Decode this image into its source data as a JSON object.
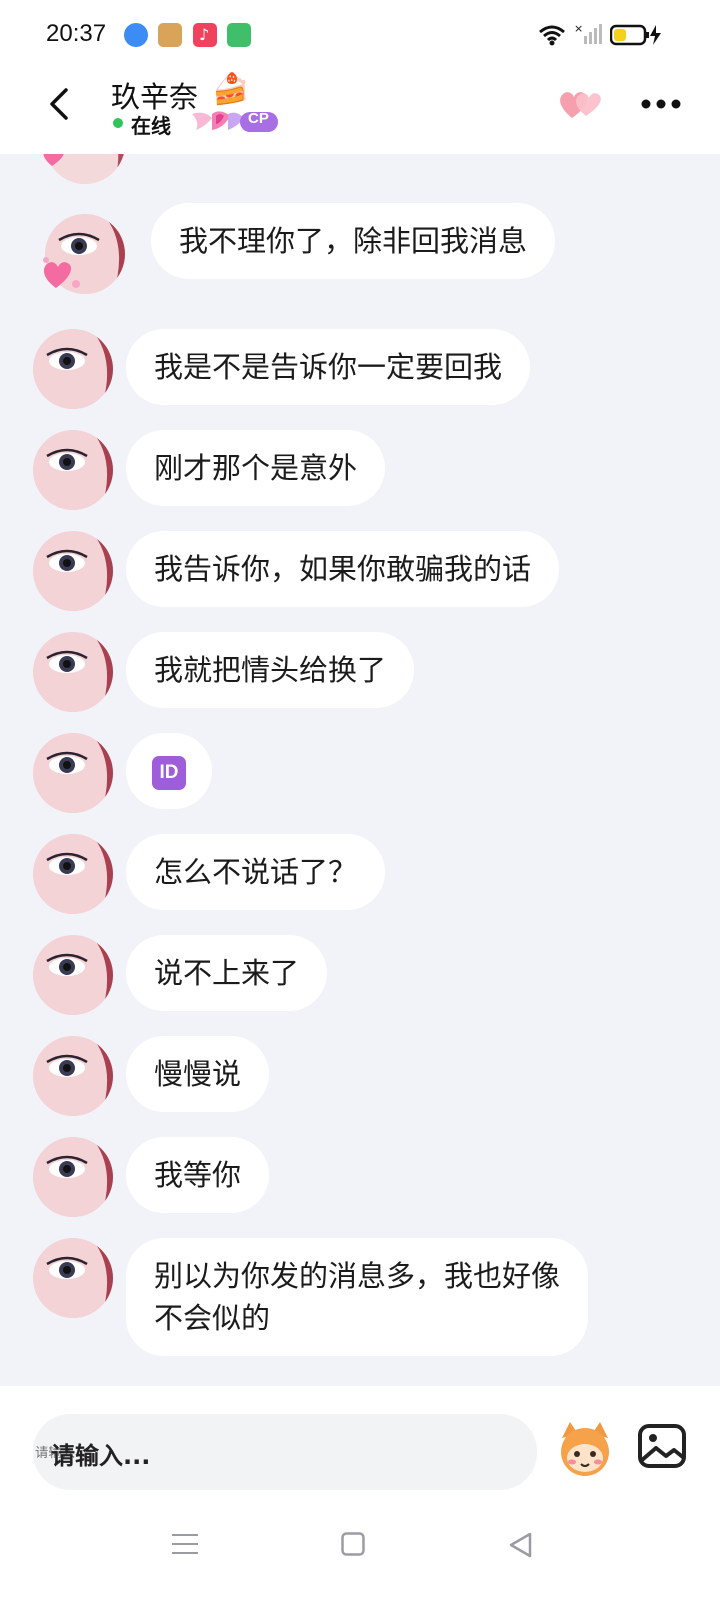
{
  "status_bar": {
    "time": "20:37",
    "app_icon_colors": [
      "#3d8cf5",
      "#d9a35a",
      "#f0425d",
      "#3fbf6a"
    ],
    "battery_color": "#f4d21c"
  },
  "header": {
    "back_icon": "chevron-left-icon",
    "contact_name": "玖辛奈",
    "name_emoji": "🍰",
    "online_status": "在线",
    "badge_label": "CP",
    "relation_icon": "double-heart-icon",
    "more_icon": "more-dots-icon",
    "accent_color": "#f48aa0"
  },
  "messages": [
    {
      "text": "我不理你了，除非回我消息"
    },
    {
      "text": "我是不是告诉你一定要回我"
    },
    {
      "text": "刚才那个是意外"
    },
    {
      "text": "我告诉你，如果你敢骗我的话"
    },
    {
      "text": "我就把情头给换了"
    },
    {
      "text": "ID",
      "kind": "id-emoji"
    },
    {
      "text": "怎么不说话了？"
    },
    {
      "text": "说不上来了"
    },
    {
      "text": "慢慢说"
    },
    {
      "text": "我等你"
    },
    {
      "text": "别以为你发的消息多，我也好像不会似的"
    }
  ],
  "composer": {
    "placeholder": "请输入...",
    "emoji_icon": "emoji-mascot-icon",
    "image_icon": "image-picker-icon"
  },
  "nav_bar": {
    "icons": [
      "menu-icon",
      "home-square-icon",
      "back-triangle-icon"
    ]
  }
}
